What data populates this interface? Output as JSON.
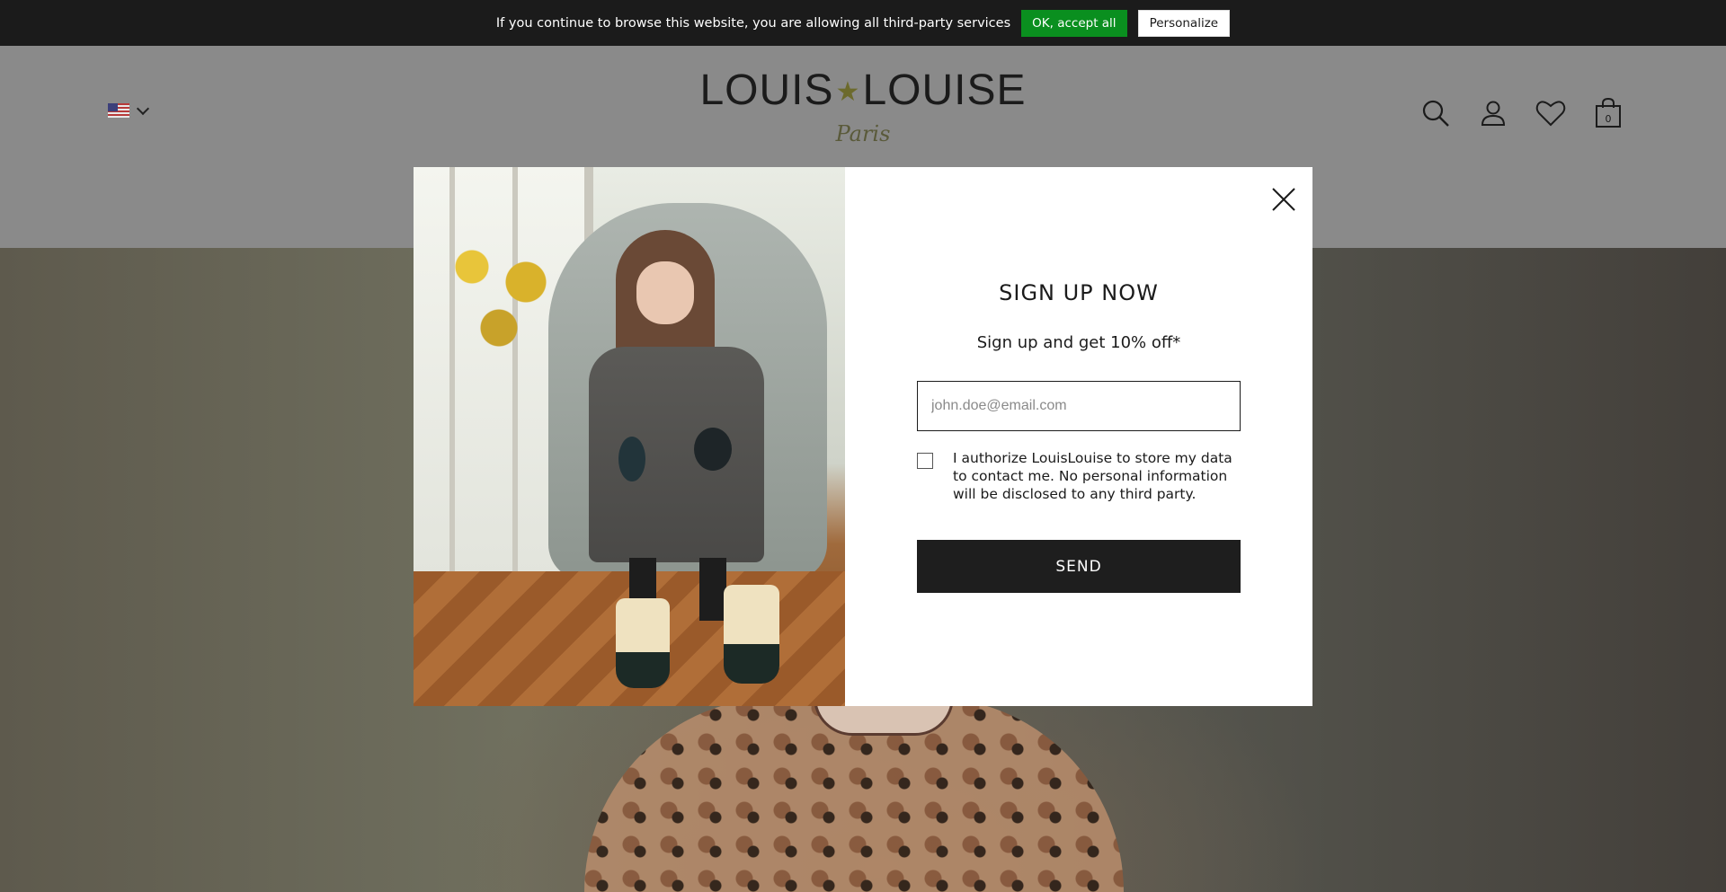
{
  "cookie_bar": {
    "message": "If you continue to browse this website, you are allowing all third-party services",
    "accept_label": "OK, accept all",
    "personalize_label": "Personalize"
  },
  "header": {
    "logo_main": "LOUIS",
    "logo_star": "★",
    "logo_main2": "LOUISE",
    "logo_sub": "Paris",
    "cart_count": "0",
    "country_flag": "us-flag"
  },
  "modal": {
    "title": "SIGN UP NOW",
    "subtitle": "Sign up and get 10% off*",
    "email_placeholder": "john.doe@email.com",
    "consent_text": "I authorize LouisLouise to store my data to contact me. No personal information will be disclosed to any third party.",
    "send_label": "SEND"
  },
  "colors": {
    "accept_green": "#0a8f1f",
    "dark": "#1e1e1e"
  }
}
